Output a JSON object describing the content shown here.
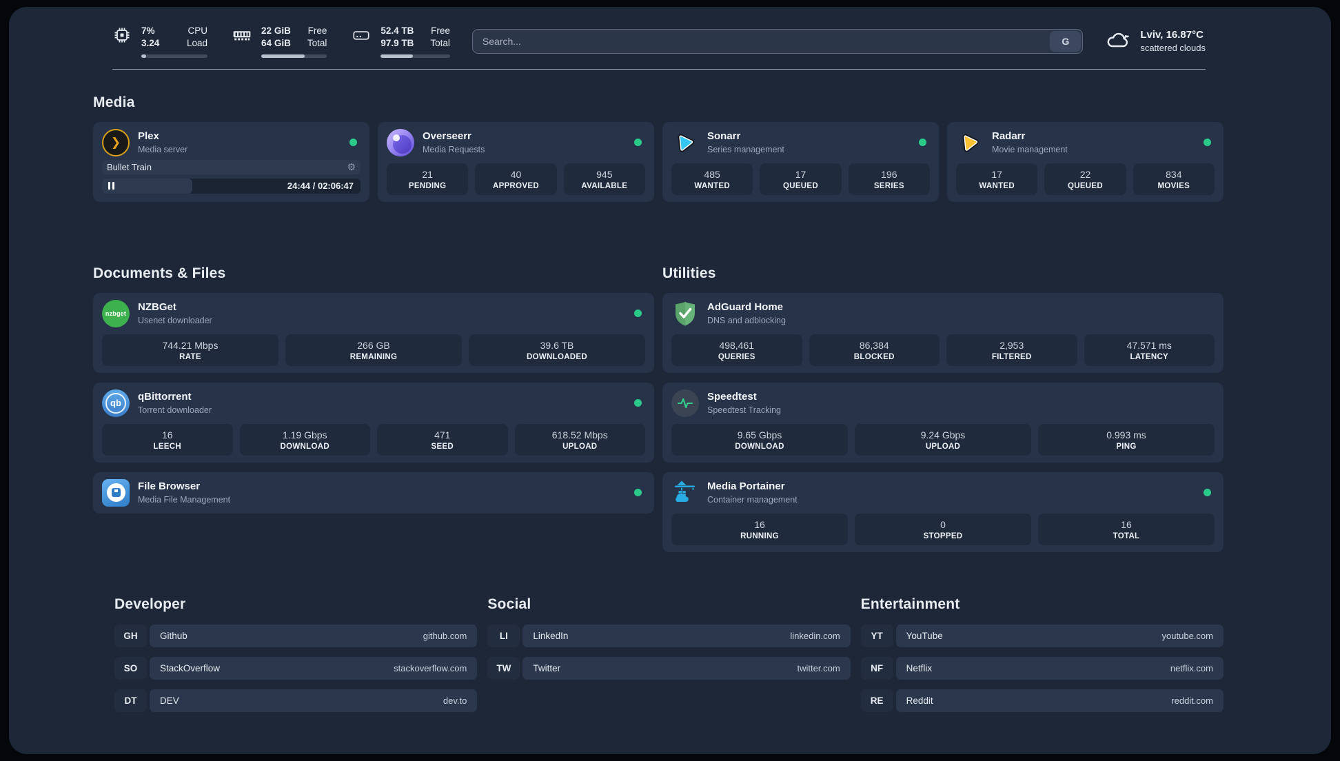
{
  "header": {
    "system_stats": [
      {
        "name": "cpu",
        "values": [
          "7%",
          "3.24"
        ],
        "labels": [
          "CPU",
          "Load"
        ],
        "progress_pct": 7
      },
      {
        "name": "memory",
        "values": [
          "22 GiB",
          "64 GiB"
        ],
        "labels": [
          "Free",
          "Total"
        ],
        "progress_pct": 66
      },
      {
        "name": "storage",
        "values": [
          "52.4 TB",
          "97.9 TB"
        ],
        "labels": [
          "Free",
          "Total"
        ],
        "progress_pct": 46
      }
    ],
    "search": {
      "placeholder": "Search...",
      "button": "G"
    },
    "weather": {
      "location_temp": "Lviv, 16.87°C",
      "condition": "scattered clouds"
    }
  },
  "media": {
    "title": "Media",
    "cards": [
      {
        "name": "Plex",
        "subtitle": "Media server",
        "online": true,
        "player": {
          "track": "Bullet Train",
          "time": "24:44 / 02:06:47",
          "progress_pct": 35
        }
      },
      {
        "name": "Overseerr",
        "subtitle": "Media Requests",
        "online": true,
        "stats": [
          {
            "value": "21",
            "label": "PENDING"
          },
          {
            "value": "40",
            "label": "APPROVED"
          },
          {
            "value": "945",
            "label": "AVAILABLE"
          }
        ]
      },
      {
        "name": "Sonarr",
        "subtitle": "Series management",
        "online": true,
        "stats": [
          {
            "value": "485",
            "label": "WANTED"
          },
          {
            "value": "17",
            "label": "QUEUED"
          },
          {
            "value": "196",
            "label": "SERIES"
          }
        ]
      },
      {
        "name": "Radarr",
        "subtitle": "Movie management",
        "online": true,
        "stats": [
          {
            "value": "17",
            "label": "WANTED"
          },
          {
            "value": "22",
            "label": "QUEUED"
          },
          {
            "value": "834",
            "label": "MOVIES"
          }
        ]
      }
    ]
  },
  "documents_files": {
    "title": "Documents & Files",
    "cards": [
      {
        "name": "NZBGet",
        "subtitle": "Usenet downloader",
        "online": true,
        "stats": [
          {
            "value": "744.21 Mbps",
            "label": "RATE"
          },
          {
            "value": "266 GB",
            "label": "REMAINING"
          },
          {
            "value": "39.6 TB",
            "label": "DOWNLOADED"
          }
        ]
      },
      {
        "name": "qBittorrent",
        "subtitle": "Torrent downloader",
        "online": true,
        "stats": [
          {
            "value": "16",
            "label": "LEECH"
          },
          {
            "value": "1.19 Gbps",
            "label": "DOWNLOAD"
          },
          {
            "value": "471",
            "label": "SEED"
          },
          {
            "value": "618.52 Mbps",
            "label": "UPLOAD"
          }
        ]
      },
      {
        "name": "File Browser",
        "subtitle": "Media File Management",
        "online": true
      }
    ]
  },
  "utilities": {
    "title": "Utilities",
    "cards": [
      {
        "name": "AdGuard Home",
        "subtitle": "DNS and adblocking",
        "stats": [
          {
            "value": "498,461",
            "label": "QUERIES"
          },
          {
            "value": "86,384",
            "label": "BLOCKED"
          },
          {
            "value": "2,953",
            "label": "FILTERED"
          },
          {
            "value": "47.571 ms",
            "label": "LATENCY"
          }
        ]
      },
      {
        "name": "Speedtest",
        "subtitle": "Speedtest Tracking",
        "stats": [
          {
            "value": "9.65 Gbps",
            "label": "DOWNLOAD"
          },
          {
            "value": "9.24 Gbps",
            "label": "UPLOAD"
          },
          {
            "value": "0.993 ms",
            "label": "PING"
          }
        ]
      },
      {
        "name": "Media Portainer",
        "subtitle": "Container management",
        "online": true,
        "stats": [
          {
            "value": "16",
            "label": "RUNNING"
          },
          {
            "value": "0",
            "label": "STOPPED"
          },
          {
            "value": "16",
            "label": "TOTAL"
          }
        ]
      }
    ]
  },
  "bookmarks": [
    {
      "title": "Developer",
      "links": [
        {
          "abbr": "GH",
          "name": "Github",
          "url": "github.com"
        },
        {
          "abbr": "SO",
          "name": "StackOverflow",
          "url": "stackoverflow.com"
        },
        {
          "abbr": "DT",
          "name": "DEV",
          "url": "dev.to"
        }
      ]
    },
    {
      "title": "Social",
      "links": [
        {
          "abbr": "LI",
          "name": "LinkedIn",
          "url": "linkedin.com"
        },
        {
          "abbr": "TW",
          "name": "Twitter",
          "url": "twitter.com"
        }
      ]
    },
    {
      "title": "Entertainment",
      "links": [
        {
          "abbr": "YT",
          "name": "YouTube",
          "url": "youtube.com"
        },
        {
          "abbr": "NF",
          "name": "Netflix",
          "url": "netflix.com"
        },
        {
          "abbr": "RE",
          "name": "Reddit",
          "url": "reddit.com"
        }
      ]
    }
  ],
  "colors": {
    "page_background": "#1d2737",
    "card_background": "#273349",
    "stat_box_background": "#1f2a3c",
    "status_online": "#2bc98a",
    "progress_fill": "#b7c0cd",
    "plex_gold": "#e5a00d",
    "sonarr_cyan": "#36c6f4",
    "radarr_gold": "#fec233",
    "nzbget_green": "#3db14d",
    "qbittorrent_blue": "#4a90d9",
    "adguard_green": "#67b279",
    "speedtest_pulse": "#2fd18c",
    "portainer_blue": "#29ace4"
  }
}
